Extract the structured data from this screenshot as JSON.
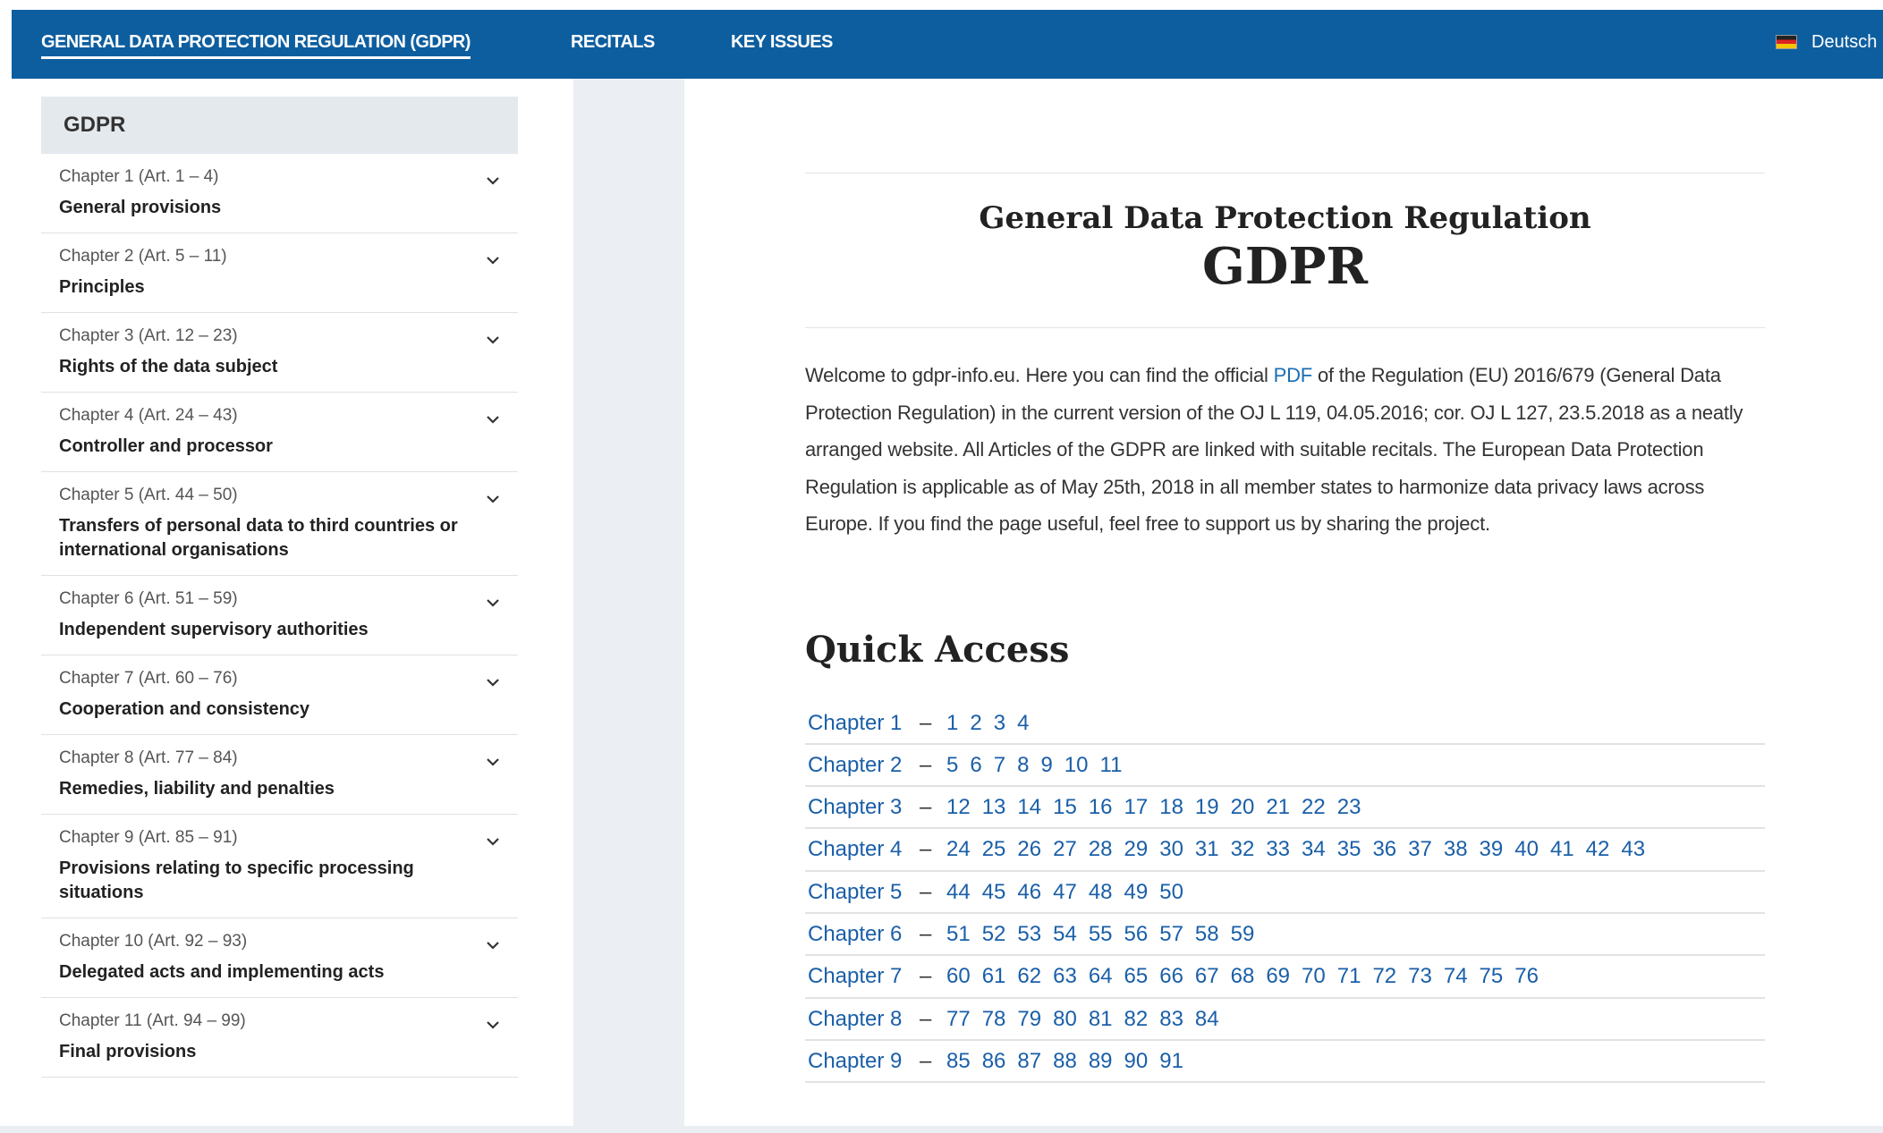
{
  "nav": {
    "items": [
      {
        "label": "GENERAL DATA PROTECTION REGULATION (GDPR)",
        "active": true
      },
      {
        "label": "RECITALS",
        "active": false
      },
      {
        "label": "KEY ISSUES",
        "active": false
      }
    ],
    "language": "Deutsch"
  },
  "sidebar": {
    "heading": "GDPR",
    "chapters": [
      {
        "range": "Chapter 1 (Art. 1 – 4)",
        "title": "General provisions"
      },
      {
        "range": "Chapter 2 (Art. 5 – 11)",
        "title": "Principles"
      },
      {
        "range": "Chapter 3 (Art. 12 – 23)",
        "title": "Rights of the data subject"
      },
      {
        "range": "Chapter 4 (Art. 24 – 43)",
        "title": "Controller and processor"
      },
      {
        "range": "Chapter 5 (Art. 44 – 50)",
        "title": "Transfers of personal data to third countries or international organisations"
      },
      {
        "range": "Chapter 6 (Art. 51 – 59)",
        "title": "Independent supervisory authorities"
      },
      {
        "range": "Chapter 7 (Art. 60 – 76)",
        "title": "Cooperation and consistency"
      },
      {
        "range": "Chapter 8 (Art. 77 – 84)",
        "title": "Remedies, liability and penalties"
      },
      {
        "range": "Chapter 9 (Art. 85 – 91)",
        "title": "Provisions relating to specific processing situations"
      },
      {
        "range": "Chapter 10 (Art. 92 – 93)",
        "title": "Delegated acts and implementing acts"
      },
      {
        "range": "Chapter 11 (Art. 94 – 99)",
        "title": "Final provisions"
      }
    ]
  },
  "main": {
    "title_line1": "General Data Protection Regulation",
    "title_line2": "GDPR",
    "intro_before_link": "Welcome to gdpr-info.eu. Here you can find the official ",
    "intro_link": "PDF",
    "intro_after_link": " of the Regulation (EU) 2016/679 (General Data Protection Regulation) in the current version of the OJ L 119, 04.05.2016; cor. OJ L 127, 23.5.2018 as a neatly arranged website. All Articles of the GDPR are linked with suitable recitals. The European Data Protection Regulation is applicable as of May 25th, 2018 in all member states to harmonize data privacy laws across Europe. If you find the page useful, feel free to support us by sharing the project.",
    "quick_access_title": "Quick Access",
    "quick_access": [
      {
        "chapter": "Chapter 1",
        "dash": "–",
        "articles": [
          "1",
          "2",
          "3",
          "4"
        ]
      },
      {
        "chapter": "Chapter 2",
        "dash": "–",
        "articles": [
          "5",
          "6",
          "7",
          "8",
          "9",
          "10",
          "11"
        ]
      },
      {
        "chapter": "Chapter 3",
        "dash": "–",
        "articles": [
          "12",
          "13",
          "14",
          "15",
          "16",
          "17",
          "18",
          "19",
          "20",
          "21",
          "22",
          "23"
        ]
      },
      {
        "chapter": "Chapter 4",
        "dash": "–",
        "articles": [
          "24",
          "25",
          "26",
          "27",
          "28",
          "29",
          "30",
          "31",
          "32",
          "33",
          "34",
          "35",
          "36",
          "37",
          "38",
          "39",
          "40",
          "41",
          "42",
          "43"
        ]
      },
      {
        "chapter": "Chapter 5",
        "dash": "–",
        "articles": [
          "44",
          "45",
          "46",
          "47",
          "48",
          "49",
          "50"
        ]
      },
      {
        "chapter": "Chapter 6",
        "dash": "–",
        "articles": [
          "51",
          "52",
          "53",
          "54",
          "55",
          "56",
          "57",
          "58",
          "59"
        ]
      },
      {
        "chapter": "Chapter 7",
        "dash": "–",
        "articles": [
          "60",
          "61",
          "62",
          "63",
          "64",
          "65",
          "66",
          "67",
          "68",
          "69",
          "70",
          "71",
          "72",
          "73",
          "74",
          "75",
          "76"
        ]
      },
      {
        "chapter": "Chapter 8",
        "dash": "–",
        "articles": [
          "77",
          "78",
          "79",
          "80",
          "81",
          "82",
          "83",
          "84"
        ]
      },
      {
        "chapter": "Chapter 9",
        "dash": "–",
        "articles": [
          "85",
          "86",
          "87",
          "88",
          "89",
          "90",
          "91"
        ]
      }
    ]
  }
}
